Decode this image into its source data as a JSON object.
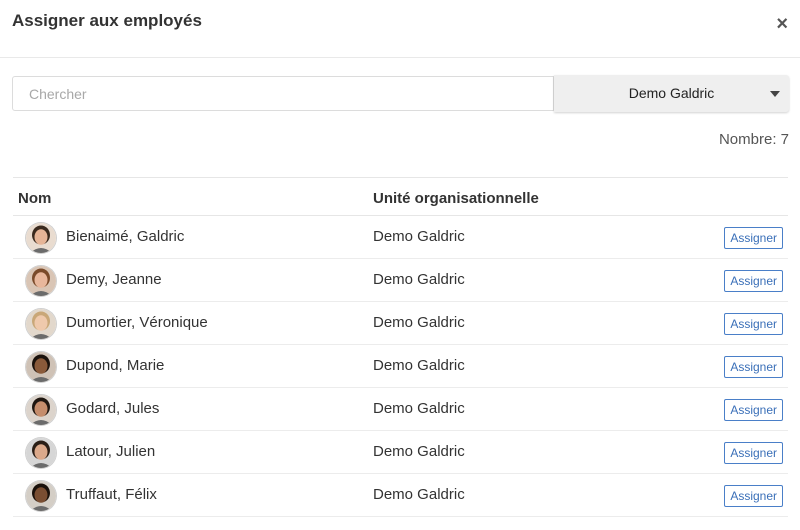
{
  "dialog": {
    "title": "Assigner aux employés",
    "close_icon": "×"
  },
  "search": {
    "placeholder": "Chercher",
    "value": ""
  },
  "unit_filter": {
    "selected": "Demo Galdric"
  },
  "count_label": "Nombre: 7",
  "table": {
    "columns": [
      "Nom",
      "Unité organisationnelle"
    ],
    "assign_label": "Assigner",
    "rows": [
      {
        "name": "Bienaimé, Galdric",
        "unit": "Demo Galdric",
        "avatar": {
          "skin": "#e6b597",
          "hair": "#3a2a1e",
          "bg": "#e9dcd0"
        }
      },
      {
        "name": "Demy, Jeanne",
        "unit": "Demo Galdric",
        "avatar": {
          "skin": "#e8b79c",
          "hair": "#7a4a2a",
          "bg": "#d9c5b5"
        }
      },
      {
        "name": "Dumortier, Véronique",
        "unit": "Demo Galdric",
        "avatar": {
          "skin": "#efc9ac",
          "hair": "#c9a778",
          "bg": "#e2d8cc"
        }
      },
      {
        "name": "Dupond, Marie",
        "unit": "Demo Galdric",
        "avatar": {
          "skin": "#8a5a3a",
          "hair": "#1b120c",
          "bg": "#cfc2b6"
        }
      },
      {
        "name": "Godard, Jules",
        "unit": "Demo Galdric",
        "avatar": {
          "skin": "#c58d6c",
          "hair": "#1f1610",
          "bg": "#dcd4cc"
        }
      },
      {
        "name": "Latour, Julien",
        "unit": "Demo Galdric",
        "avatar": {
          "skin": "#dba98b",
          "hair": "#2a1e16",
          "bg": "#d6d6d6"
        }
      },
      {
        "name": "Truffaut, Félix",
        "unit": "Demo Galdric",
        "avatar": {
          "skin": "#7a4e32",
          "hair": "#1a110b",
          "bg": "#d4cec6"
        }
      }
    ]
  }
}
